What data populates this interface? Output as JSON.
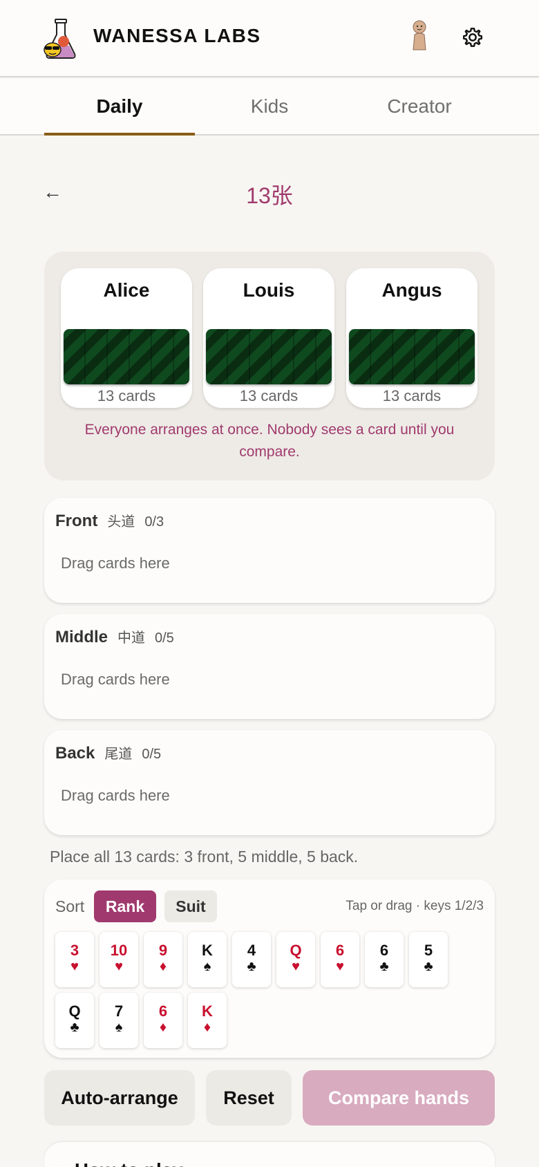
{
  "header": {
    "brand": "WANESSA LABS",
    "logo_icon": "flask-mascot-icon",
    "avatar_icon": "player-pawn-icon",
    "settings_icon": "gear-icon"
  },
  "tabs": [
    {
      "label": "Daily",
      "active": true
    },
    {
      "label": "Kids",
      "active": false
    },
    {
      "label": "Creator",
      "active": false
    }
  ],
  "game": {
    "back": "←",
    "title": "13张"
  },
  "players": [
    {
      "name": "Alice",
      "count": "13 cards"
    },
    {
      "name": "Louis",
      "count": "13 cards"
    },
    {
      "name": "Angus",
      "count": "13 cards"
    }
  ],
  "players_note": "Everyone arranges at once. Nobody sees a card until you compare.",
  "rows": [
    {
      "label": "Front",
      "cn": "头道",
      "count": "0/3",
      "placeholder": "Drag cards here"
    },
    {
      "label": "Middle",
      "cn": "中道",
      "count": "0/5",
      "placeholder": "Drag cards here"
    },
    {
      "label": "Back",
      "cn": "尾道",
      "count": "0/5",
      "placeholder": "Drag cards here"
    }
  ],
  "hint": "Place all 13 cards: 3 front, 5 middle, 5 back.",
  "hand": {
    "sort_label": "Sort",
    "sort_rank": "Rank",
    "sort_suit": "Suit",
    "active_sort": "Rank",
    "hint": "Tap or drag · keys 1/2/3",
    "cards": [
      {
        "rank": "3",
        "suit": "♥",
        "color": "red"
      },
      {
        "rank": "10",
        "suit": "♥",
        "color": "red"
      },
      {
        "rank": "9",
        "suit": "♦",
        "color": "red"
      },
      {
        "rank": "K",
        "suit": "♠",
        "color": "black"
      },
      {
        "rank": "4",
        "suit": "♣",
        "color": "black"
      },
      {
        "rank": "Q",
        "suit": "♥",
        "color": "red"
      },
      {
        "rank": "6",
        "suit": "♥",
        "color": "red"
      },
      {
        "rank": "6",
        "suit": "♣",
        "color": "black"
      },
      {
        "rank": "5",
        "suit": "♣",
        "color": "black"
      },
      {
        "rank": "Q",
        "suit": "♣",
        "color": "black"
      },
      {
        "rank": "7",
        "suit": "♠",
        "color": "black"
      },
      {
        "rank": "6",
        "suit": "♦",
        "color": "red"
      },
      {
        "rank": "K",
        "suit": "♦",
        "color": "red"
      }
    ]
  },
  "actions": {
    "auto": "Auto-arrange",
    "reset": "Reset",
    "compare": "Compare hands"
  },
  "colors": {
    "accent": "#a03a6e",
    "tab_underline": "#8a5b17",
    "compare_disabled": "#d8abbf",
    "card_red": "#c8102e"
  },
  "bottom_section": {
    "title": "▸ How to play"
  }
}
